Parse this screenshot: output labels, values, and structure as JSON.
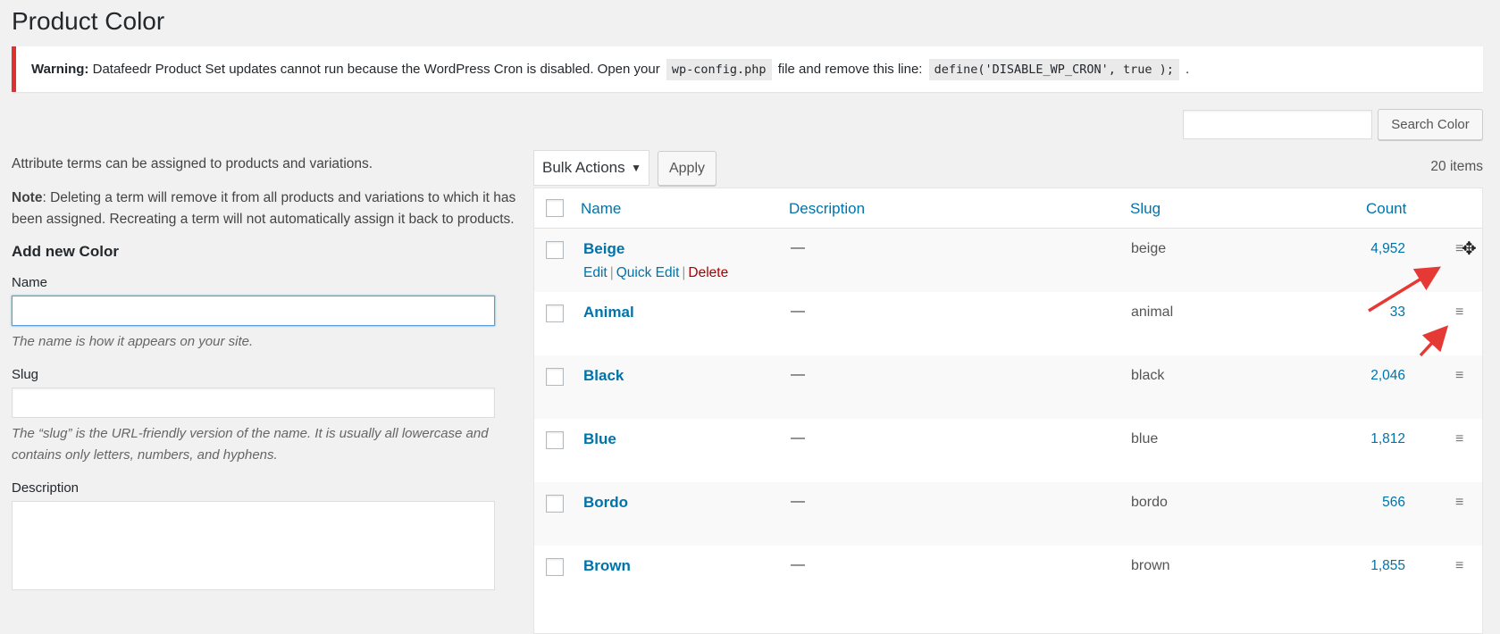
{
  "page": {
    "title": "Product Color"
  },
  "notice": {
    "label": "Warning:",
    "text_before": " Datafeedr Product Set updates cannot run because the WordPress Cron is disabled. Open your ",
    "code1": "wp-config.php",
    "text_middle": " file and remove this line: ",
    "code2": "define('DISABLE_WP_CRON', true );",
    "text_after": " ."
  },
  "search": {
    "button_label": "Search Color",
    "value": ""
  },
  "left": {
    "intro": "Attribute terms can be assigned to products and variations.",
    "note_label": "Note",
    "note_text": ": Deleting a term will remove it from all products and variations to which it has been assigned. Recreating a term will not automatically assign it back to products.",
    "add_heading": "Add new Color",
    "name_label": "Name",
    "name_help": "The name is how it appears on your site.",
    "slug_label": "Slug",
    "slug_help": "The “slug” is the URL-friendly version of the name. It is usually all lowercase and contains only letters, numbers, and hyphens.",
    "description_label": "Description"
  },
  "toolbar": {
    "bulk_actions": "Bulk Actions",
    "apply_label": "Apply",
    "items_count": "20 items"
  },
  "table": {
    "columns": {
      "name": "Name",
      "description": "Description",
      "slug": "Slug",
      "count": "Count"
    },
    "row_actions": {
      "edit": "Edit",
      "quick_edit": "Quick Edit",
      "delete": "Delete",
      "separator": "|"
    },
    "handle_glyph": "≡",
    "rows": [
      {
        "name": "Beige",
        "description": "—",
        "slug": "beige",
        "count": "4,952"
      },
      {
        "name": "Animal",
        "description": "—",
        "slug": "animal",
        "count": "33"
      },
      {
        "name": "Black",
        "description": "—",
        "slug": "black",
        "count": "2,046"
      },
      {
        "name": "Blue",
        "description": "—",
        "slug": "blue",
        "count": "1,812"
      },
      {
        "name": "Bordo",
        "description": "—",
        "slug": "bordo",
        "count": "566"
      },
      {
        "name": "Brown",
        "description": "—",
        "slug": "brown",
        "count": "1,855"
      }
    ]
  },
  "colors": {
    "link": "#0073aa",
    "danger": "#a00",
    "notice_border": "#dc3232",
    "annotation_arrow": "#e53935"
  },
  "icons": {
    "sort_handle": "menu-icon",
    "cursor": "move-cursor-icon",
    "dropdown": "caret-down-icon"
  }
}
